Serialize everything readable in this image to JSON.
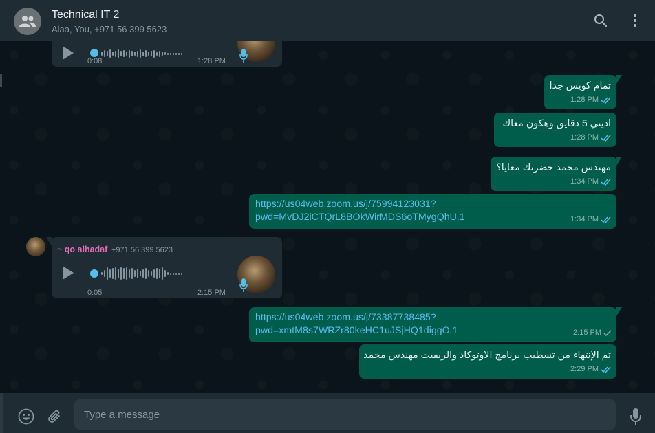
{
  "header": {
    "title": "Technical IT 2",
    "subtitle": "Alaa, You, +971 56 399 5623"
  },
  "messages": [
    {
      "type": "voice",
      "direction": "in",
      "duration": "0:08",
      "time": "1:28 PM"
    },
    {
      "type": "text",
      "direction": "out",
      "text": "تمام كويس جدا",
      "time": "1:28 PM"
    },
    {
      "type": "text",
      "direction": "out",
      "text": "اديني 5 دقايق وهكون معاك",
      "time": "1:28 PM"
    },
    {
      "type": "text",
      "direction": "out",
      "text": "مهندس محمد حضرتك معايا؟",
      "time": "1:34 PM"
    },
    {
      "type": "link",
      "direction": "out",
      "line1": "https://us04web.zoom.us/j/75994123031?",
      "line2": "pwd=MvDJ2iCTQrL8BOkWirMDS6oTMygQhU.1",
      "time": "1:34 PM"
    },
    {
      "type": "voice",
      "direction": "in",
      "sender": "~ qo alhadaf",
      "phone": "+971 56 399 5623",
      "duration": "0:05",
      "time": "2:15 PM"
    },
    {
      "type": "link",
      "direction": "out",
      "line1": "https://us04web.zoom.us/j/73387738485?",
      "line2": "pwd=xmtM8s7WRZr80keHC1uJSjHQ1diggO.1",
      "time": "2:15 PM"
    },
    {
      "type": "text",
      "direction": "out",
      "text": "تم الإنتهاء من تسطيب برنامج الاوتوكاد والريفيت مهندس محمد",
      "time": "2:29 PM"
    }
  ],
  "composer": {
    "placeholder": "Type a message"
  },
  "icons": {
    "group_avatar": "group-icon",
    "search": "search-icon",
    "menu": "menu-icon",
    "emoji": "emoji-icon",
    "attach": "attach-icon",
    "mic": "mic-icon",
    "play": "play-icon",
    "read_receipt": "double-check-icon",
    "sent_receipt": "single-check-icon"
  },
  "colors": {
    "outgoing_bubble": "#005c4b",
    "incoming_bubble": "#202c33",
    "link": "#53bdeb",
    "sender_name": "#e26ab6",
    "read_tick": "#53bdeb"
  }
}
